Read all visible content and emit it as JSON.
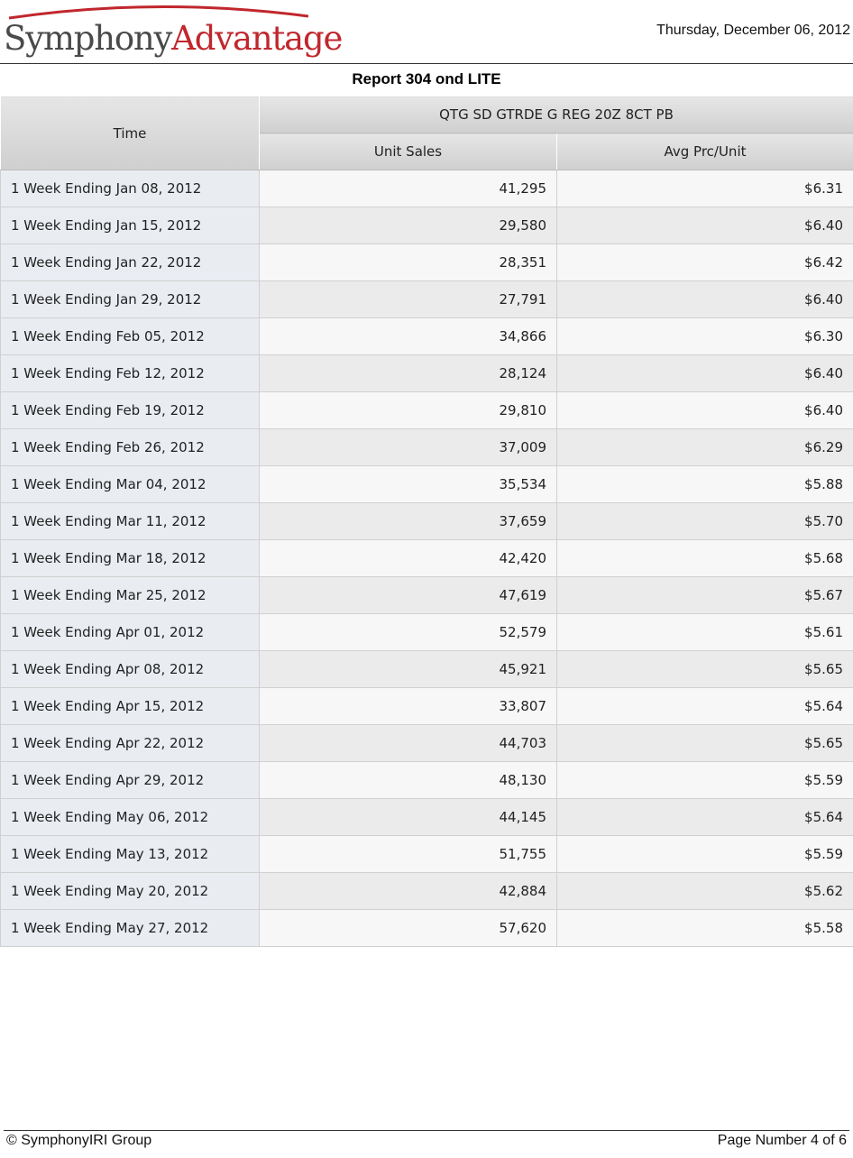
{
  "header": {
    "logo_part1": "Symphony",
    "logo_part2": "Advantage",
    "report_date": "Thursday, December 06, 2012",
    "brand_color": "#c0272d"
  },
  "title": "Report 304 ond LITE",
  "table": {
    "time_header": "Time",
    "product_header": "QTG SD GTRDE G REG 20Z 8CT PB",
    "columns": [
      "Unit Sales",
      "Avg Prc/Unit"
    ],
    "rows": [
      {
        "time": "1 Week Ending Jan 08, 2012",
        "unit_sales": "41,295",
        "avg_price": "$6.31"
      },
      {
        "time": "1 Week Ending Jan 15, 2012",
        "unit_sales": "29,580",
        "avg_price": "$6.40"
      },
      {
        "time": "1 Week Ending Jan 22, 2012",
        "unit_sales": "28,351",
        "avg_price": "$6.42"
      },
      {
        "time": "1 Week Ending Jan 29, 2012",
        "unit_sales": "27,791",
        "avg_price": "$6.40"
      },
      {
        "time": "1 Week Ending Feb 05, 2012",
        "unit_sales": "34,866",
        "avg_price": "$6.30"
      },
      {
        "time": "1 Week Ending Feb 12, 2012",
        "unit_sales": "28,124",
        "avg_price": "$6.40"
      },
      {
        "time": "1 Week Ending Feb 19, 2012",
        "unit_sales": "29,810",
        "avg_price": "$6.40"
      },
      {
        "time": "1 Week Ending Feb 26, 2012",
        "unit_sales": "37,009",
        "avg_price": "$6.29"
      },
      {
        "time": "1 Week Ending Mar 04, 2012",
        "unit_sales": "35,534",
        "avg_price": "$5.88"
      },
      {
        "time": "1 Week Ending Mar 11, 2012",
        "unit_sales": "37,659",
        "avg_price": "$5.70"
      },
      {
        "time": "1 Week Ending Mar 18, 2012",
        "unit_sales": "42,420",
        "avg_price": "$5.68"
      },
      {
        "time": "1 Week Ending Mar 25, 2012",
        "unit_sales": "47,619",
        "avg_price": "$5.67"
      },
      {
        "time": "1 Week Ending Apr 01, 2012",
        "unit_sales": "52,579",
        "avg_price": "$5.61"
      },
      {
        "time": "1 Week Ending Apr 08, 2012",
        "unit_sales": "45,921",
        "avg_price": "$5.65"
      },
      {
        "time": "1 Week Ending Apr 15, 2012",
        "unit_sales": "33,807",
        "avg_price": "$5.64"
      },
      {
        "time": "1 Week Ending Apr 22, 2012",
        "unit_sales": "44,703",
        "avg_price": "$5.65"
      },
      {
        "time": "1 Week Ending Apr 29, 2012",
        "unit_sales": "48,130",
        "avg_price": "$5.59"
      },
      {
        "time": "1 Week Ending May 06, 2012",
        "unit_sales": "44,145",
        "avg_price": "$5.64"
      },
      {
        "time": "1 Week Ending May 13, 2012",
        "unit_sales": "51,755",
        "avg_price": "$5.59"
      },
      {
        "time": "1 Week Ending May 20, 2012",
        "unit_sales": "42,884",
        "avg_price": "$5.62"
      },
      {
        "time": "1 Week Ending May 27, 2012",
        "unit_sales": "57,620",
        "avg_price": "$5.58"
      }
    ]
  },
  "footer": {
    "copyright": "© SymphonyIRI Group",
    "page_number": "Page Number 4 of 6"
  }
}
